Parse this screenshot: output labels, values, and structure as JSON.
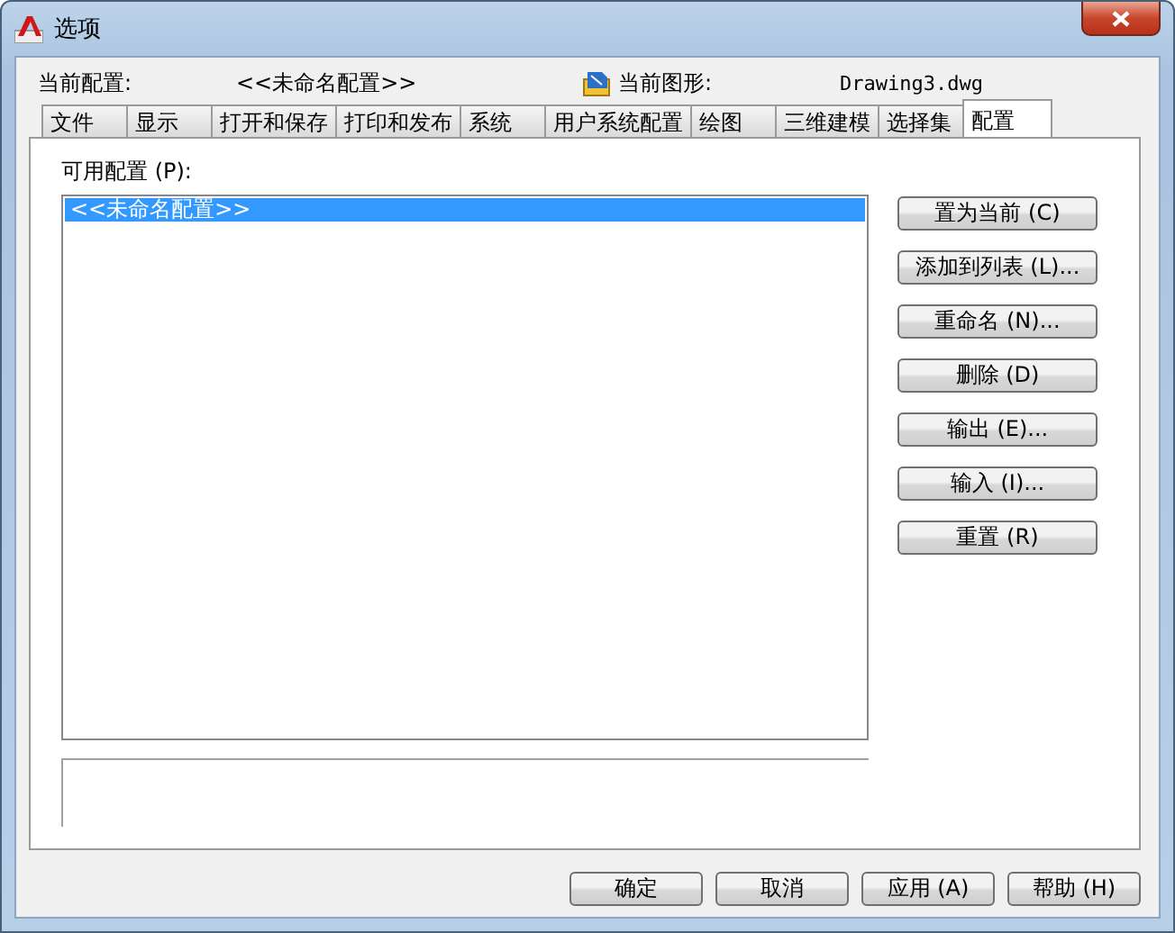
{
  "window": {
    "title": "选项"
  },
  "header": {
    "profile_label": "当前配置:",
    "profile_value": "<<未命名配置>>",
    "drawing_label": "当前图形:",
    "drawing_value": "Drawing3.dwg"
  },
  "tabs": [
    {
      "label": "文件",
      "selected": false
    },
    {
      "label": "显示",
      "selected": false
    },
    {
      "label": "打开和保存",
      "selected": false
    },
    {
      "label": "打印和发布",
      "selected": false
    },
    {
      "label": "系统",
      "selected": false
    },
    {
      "label": "用户系统配置",
      "selected": false
    },
    {
      "label": "绘图",
      "selected": false
    },
    {
      "label": "三维建模",
      "selected": false
    },
    {
      "label": "选择集",
      "selected": false
    },
    {
      "label": "配置",
      "selected": true
    }
  ],
  "profiles": {
    "label": "可用配置 (P):",
    "items": [
      {
        "label": "<<未命名配置>>",
        "selected": true
      }
    ]
  },
  "side_buttons": [
    "置为当前 (C)",
    "添加到列表 (L)...",
    "重命名 (N)...",
    "删除 (D)",
    "输出 (E)...",
    "输入 (I)...",
    "重置 (R)"
  ],
  "buttons": [
    "确定",
    "取消",
    "应用 (A)",
    "帮助 (H)"
  ]
}
